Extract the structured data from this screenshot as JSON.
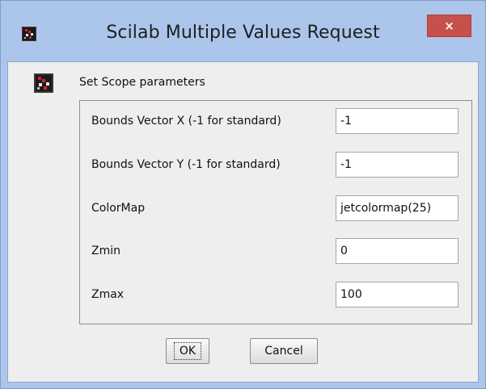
{
  "window": {
    "title": "Scilab Multiple Values Request",
    "close_label": "×"
  },
  "dialog": {
    "header": "Set Scope parameters",
    "fields": [
      {
        "label": "Bounds Vector X (-1 for standard)",
        "value": "-1"
      },
      {
        "label": "Bounds Vector Y (-1 for standard)",
        "value": "-1"
      },
      {
        "label": "ColorMap",
        "value": "jetcolormap(25)"
      },
      {
        "label": "Zmin",
        "value": "0"
      },
      {
        "label": "Zmax",
        "value": "100"
      }
    ],
    "ok_label": "OK",
    "cancel_label": "Cancel"
  },
  "icons": {
    "title": "scilab-logo-icon",
    "header": "scilab-logo-icon"
  },
  "colors": {
    "title_bar": "#abc6ea",
    "close_button": "#c7504a",
    "panel": "#eeeeee"
  }
}
